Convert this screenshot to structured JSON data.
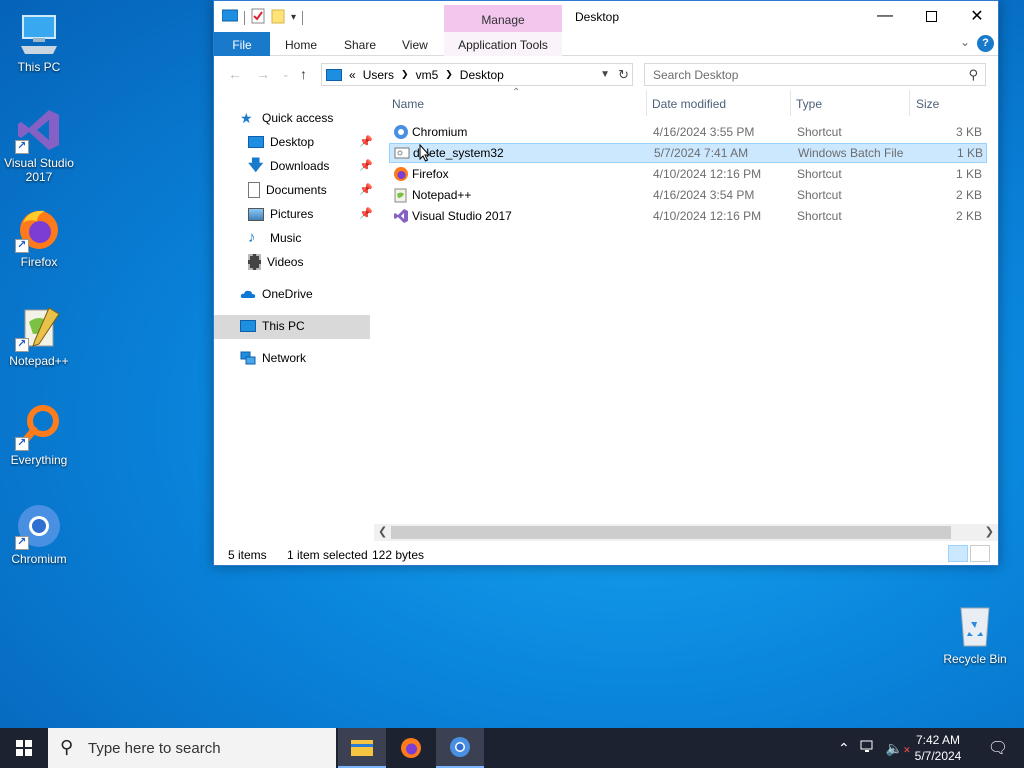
{
  "desktop": {
    "icons": [
      {
        "label": "This PC"
      },
      {
        "label": "Visual Studio 2017"
      },
      {
        "label": "Firefox"
      },
      {
        "label": "Notepad++"
      },
      {
        "label": "Everything"
      },
      {
        "label": "Chromium"
      },
      {
        "label": "Recycle Bin"
      }
    ]
  },
  "window": {
    "title": "Desktop",
    "manage_tab": "Manage",
    "ribbon_tabs": [
      "File",
      "Home",
      "Share",
      "View",
      "Application Tools"
    ],
    "help_label": "?",
    "address": {
      "prefix": "«",
      "crumbs": [
        "Users",
        "vm5",
        "Desktop"
      ]
    },
    "search": {
      "placeholder": "Search Desktop"
    },
    "sidebar": {
      "items": [
        {
          "label": "Quick access",
          "icon": "star-icon"
        },
        {
          "label": "Desktop",
          "icon": "desktop-icon",
          "pinned": true
        },
        {
          "label": "Downloads",
          "icon": "download-icon",
          "pinned": true
        },
        {
          "label": "Documents",
          "icon": "document-icon",
          "pinned": true
        },
        {
          "label": "Pictures",
          "icon": "picture-icon",
          "pinned": true
        },
        {
          "label": "Music",
          "icon": "music-icon"
        },
        {
          "label": "Videos",
          "icon": "video-icon"
        },
        {
          "label": "OneDrive",
          "icon": "cloud-icon"
        },
        {
          "label": "This PC",
          "icon": "computer-icon",
          "selected": true
        },
        {
          "label": "Network",
          "icon": "network-icon"
        }
      ]
    },
    "columns": {
      "name": "Name",
      "date": "Date modified",
      "type": "Type",
      "size": "Size"
    },
    "files": [
      {
        "name": "Chromium",
        "date": "4/16/2024 3:55 PM",
        "type": "Shortcut",
        "size": "3 KB",
        "icon": "chromium-icon"
      },
      {
        "name": "delete_system32",
        "date": "5/7/2024 7:41 AM",
        "type": "Windows Batch File",
        "size": "1 KB",
        "icon": "batch-file-icon",
        "selected": true
      },
      {
        "name": "Firefox",
        "date": "4/10/2024 12:16 PM",
        "type": "Shortcut",
        "size": "1 KB",
        "icon": "firefox-icon"
      },
      {
        "name": "Notepad++",
        "date": "4/16/2024 3:54 PM",
        "type": "Shortcut",
        "size": "2 KB",
        "icon": "notepadpp-icon"
      },
      {
        "name": "Visual Studio 2017",
        "date": "4/10/2024 12:16 PM",
        "type": "Shortcut",
        "size": "2 KB",
        "icon": "visual-studio-icon"
      }
    ],
    "status": {
      "items": "5 items",
      "selection": "1 item selected",
      "bytes": "122 bytes"
    }
  },
  "taskbar": {
    "search_placeholder": "Type here to search",
    "time": "7:42 AM",
    "date": "5/7/2024"
  },
  "colors": {
    "accent": "#1979ca",
    "manage": "#f3c6ee",
    "selection": "#cce8ff",
    "taskbar": "#1d2230"
  }
}
